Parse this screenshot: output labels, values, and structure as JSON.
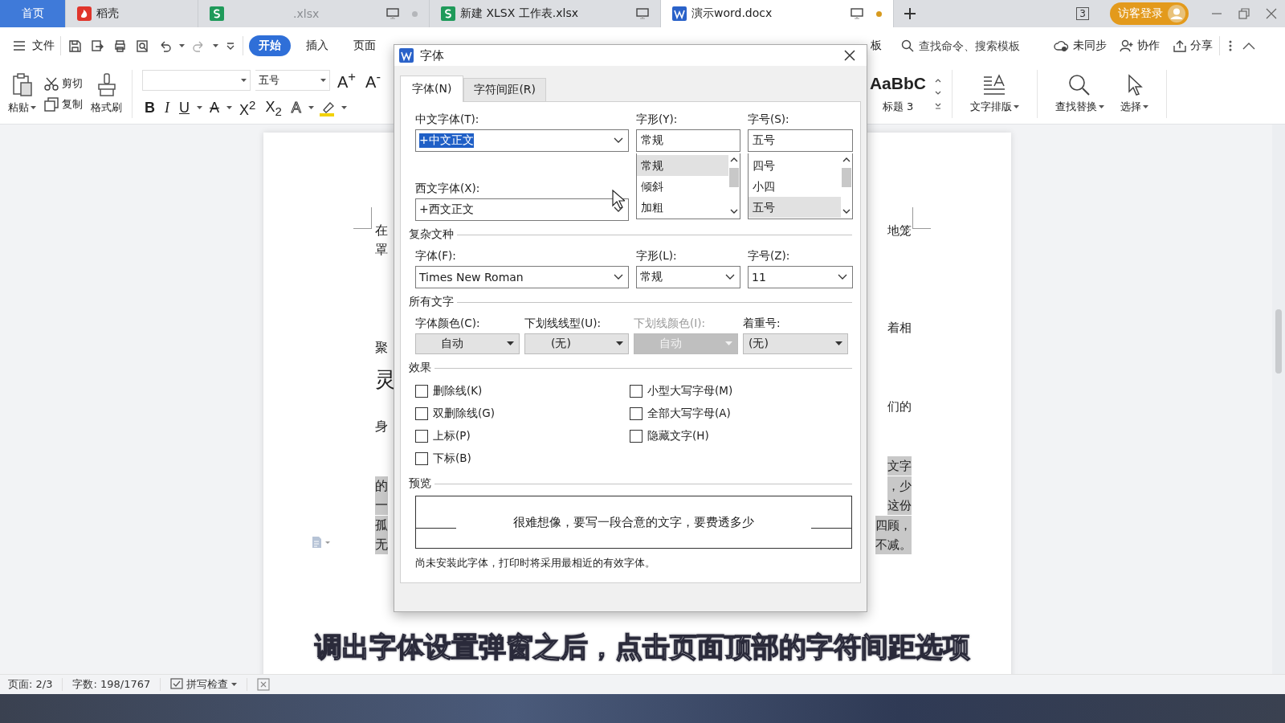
{
  "app_tabs": [
    {
      "kind": "home",
      "label": "首页",
      "selected": false
    },
    {
      "kind": "docer",
      "label": "稻壳",
      "selected": false
    },
    {
      "kind": "sheet",
      "label": ".xlsx",
      "selected": false,
      "modified": false
    },
    {
      "kind": "sheet",
      "label": "新建 XLSX 工作表.xlsx",
      "selected": false
    },
    {
      "kind": "writer",
      "label": "演示word.docx",
      "selected": true,
      "modified": true
    }
  ],
  "window_badge": "3",
  "login_button": "访客登录",
  "menu": {
    "file": "文件",
    "ribbon_tabs": [
      {
        "label": "开始",
        "selected": true
      },
      {
        "label": "插入",
        "selected": false
      },
      {
        "label": "页面",
        "selected": false
      }
    ],
    "ribbon_tabs_right": [
      {
        "label": "板",
        "selected": false
      }
    ],
    "search": {
      "placeholder": "查找命令、搜索模板"
    },
    "actions": [
      {
        "kind": "cloud",
        "label": "未同步"
      },
      {
        "kind": "user",
        "label": "协作"
      },
      {
        "kind": "share",
        "label": "分享"
      }
    ]
  },
  "ribbon": {
    "paste": "粘贴",
    "cut": "剪切",
    "copy": "复制",
    "format_painter": "格式刷",
    "font_size": "五号",
    "format_buttons": [
      {
        "kind": "bold",
        "label": "B"
      },
      {
        "kind": "italic",
        "label": "I"
      },
      {
        "kind": "underline",
        "label": "U"
      },
      {
        "kind": "strike",
        "label": "A"
      },
      {
        "kind": "sup",
        "label": "X$^{2}$"
      },
      {
        "kind": "sub",
        "label": "X$_{2}$"
      },
      {
        "kind": "outline",
        "label": "A"
      }
    ],
    "grow": "A$^{+}$",
    "shrink": "A$^{-}$",
    "style_preview": "AaBbC",
    "style_name": "标题 3",
    "tools": [
      {
        "kind": "layout",
        "label": "文字排版"
      },
      {
        "kind": "find",
        "label": "查找替换"
      },
      {
        "kind": "select",
        "label": "选择"
      }
    ]
  },
  "document": {
    "fragments": [
      {
        "kind": "left",
        "text": "在",
        "highlighted": false
      },
      {
        "kind": "left",
        "text": "罩",
        "highlighted": false
      },
      {
        "kind": "left",
        "text": "聚",
        "highlighted": false
      },
      {
        "kind": "left",
        "text": "灵",
        "highlighted": false
      },
      {
        "kind": "left",
        "text": "身",
        "highlighted": false
      },
      {
        "kind": "left",
        "text": "的",
        "highlighted": true
      },
      {
        "kind": "left",
        "text": "一",
        "highlighted": true
      },
      {
        "kind": "left",
        "text": "孤",
        "highlighted": true
      },
      {
        "kind": "left",
        "text": "无",
        "highlighted": true
      },
      {
        "kind": "right",
        "text": "地笼",
        "highlighted": false
      },
      {
        "kind": "right",
        "text": "着相",
        "highlighted": false
      },
      {
        "kind": "right",
        "text": "们的",
        "highlighted": false
      },
      {
        "kind": "right",
        "text": "文字",
        "highlighted": true
      },
      {
        "kind": "right",
        "text": "，少",
        "highlighted": true
      },
      {
        "kind": "right",
        "text": "这份",
        "highlighted": true
      },
      {
        "kind": "right",
        "text": "四顾，",
        "highlighted": true
      },
      {
        "kind": "right",
        "text": "不减。",
        "highlighted": true
      }
    ]
  },
  "status_bar": {
    "page": "页面: 2/3",
    "words": "字数: 198/1767",
    "spell_check": "拼写检查"
  },
  "caption": "调出字体设置弹窗之后，点击页面顶部的字符间距选项",
  "dialog": {
    "title": "字体",
    "tabs": [
      {
        "label": "字体(N)",
        "selected": true
      },
      {
        "label": "字符间距(R)",
        "selected": false
      }
    ],
    "chinese_font": {
      "label": "中文字体(T):",
      "value": "+中文正文"
    },
    "western_font": {
      "label": "西文字体(X):",
      "value": "+西文正文"
    },
    "style": {
      "label": "字形(Y):",
      "value": "常规",
      "options": [
        {
          "label": "常规",
          "selected": true
        },
        {
          "label": "倾斜",
          "selected": false
        },
        {
          "label": "加粗",
          "selected": false
        }
      ]
    },
    "size": {
      "label": "字号(S):",
      "value": "五号",
      "options": [
        {
          "label": "四号",
          "selected": false
        },
        {
          "label": "小四",
          "selected": false
        },
        {
          "label": "五号",
          "selected": true
        }
      ]
    },
    "complex_title": "复杂文种",
    "complex_fields": [
      {
        "label": "字体(F):",
        "value": "Times New Roman"
      },
      {
        "label": "字形(L):",
        "value": "常规"
      },
      {
        "label": "字号(Z):",
        "value": "11"
      }
    ],
    "all_text_title": "所有文字",
    "all_text_fields": [
      {
        "label": "字体颜色(C):",
        "value": "自动",
        "disabled": false
      },
      {
        "label": "下划线线型(U):",
        "value": "(无)",
        "disabled": false
      },
      {
        "label": "下划线颜色(I):",
        "value": "自动",
        "disabled": true
      },
      {
        "label": "着重号:",
        "value": "(无)",
        "disabled": false
      }
    ],
    "effects_title": "效果",
    "effects_left": [
      {
        "label": "删除线(K)",
        "checked": false
      },
      {
        "label": "双删除线(G)",
        "checked": false
      },
      {
        "label": "上标(P)",
        "checked": false
      },
      {
        "label": "下标(B)",
        "checked": false
      }
    ],
    "effects_right": [
      {
        "label": "小型大写字母(M)",
        "checked": false
      },
      {
        "label": "全部大写字母(A)",
        "checked": false
      },
      {
        "label": "隐藏文字(H)",
        "checked": false
      }
    ],
    "preview_title": "预览",
    "preview_text": "很难想像，要写一段合意的文字，要费透多少",
    "note": "尚未安装此字体，打印时将采用最相近的有效字体。"
  }
}
